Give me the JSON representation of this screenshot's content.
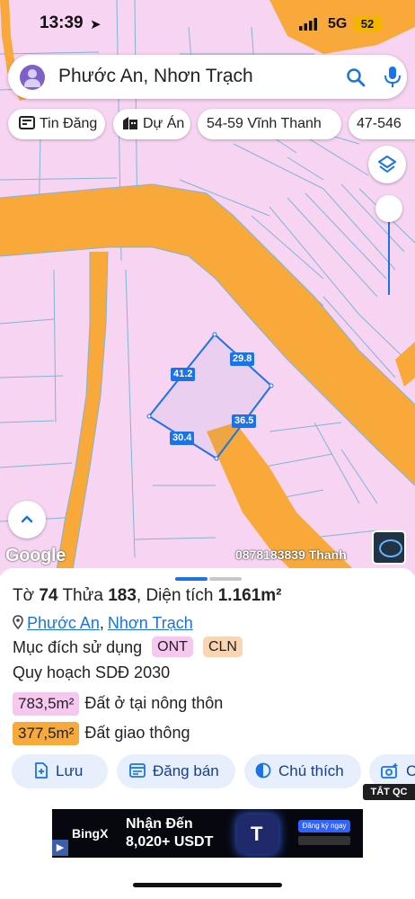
{
  "status_bar": {
    "time": "13:39",
    "network": "5G",
    "battery": "52"
  },
  "search": {
    "query": "Phước An, Nhơn Trạch"
  },
  "chips": [
    {
      "label": "Tin Đăng",
      "icon": "newspaper-icon"
    },
    {
      "label": "Dự Án",
      "icon": "building-icon"
    },
    {
      "label": "54-59 Vĩnh Thanh"
    },
    {
      "label": "47-546"
    }
  ],
  "map": {
    "google_label": "Google",
    "watermark": "0878183839 Thanh",
    "parcel_edges": [
      "41.2",
      "29.8",
      "36.5",
      "30.4"
    ],
    "colors": {
      "residential": "#f7d4f2",
      "road": "#f9a93a",
      "parcel_line": "#3a8fc9",
      "highlight": "#1a73e8"
    }
  },
  "sheet": {
    "title": {
      "prefix1": "Tờ",
      "sheet_no": "74",
      "prefix2": "Thửa",
      "plot_no": "183",
      "area_label": ", Diện tích",
      "area_value": "1.161m²"
    },
    "address": {
      "ward": "Phước An",
      "sep": ",",
      "district": "Nhơn Trạch"
    },
    "purpose": {
      "label": "Mục đích sử dụng",
      "tags": [
        "ONT",
        "CLN"
      ]
    },
    "plan_label": "Quy hoạch SDĐ 2030",
    "areas": [
      {
        "value": "783,5m²",
        "label": "Đất ở tại nông thôn",
        "color": "#f6c8ef"
      },
      {
        "value": "377,5m²",
        "label": "Đất giao thông",
        "color": "#f7a93c"
      }
    ],
    "actions": [
      {
        "label": "Lưu",
        "icon": "save-add-icon"
      },
      {
        "label": "Đăng bán",
        "icon": "listing-icon"
      },
      {
        "label": "Chú thích",
        "icon": "legend-icon"
      },
      {
        "label": "C",
        "icon": "camera-icon"
      }
    ],
    "ad_close_label": "TẮT QC",
    "ad": {
      "brand": "BingX",
      "line1": "Nhận Đến",
      "line2": "8,020+ USDT",
      "cta": "Đăng ký ngay"
    }
  }
}
